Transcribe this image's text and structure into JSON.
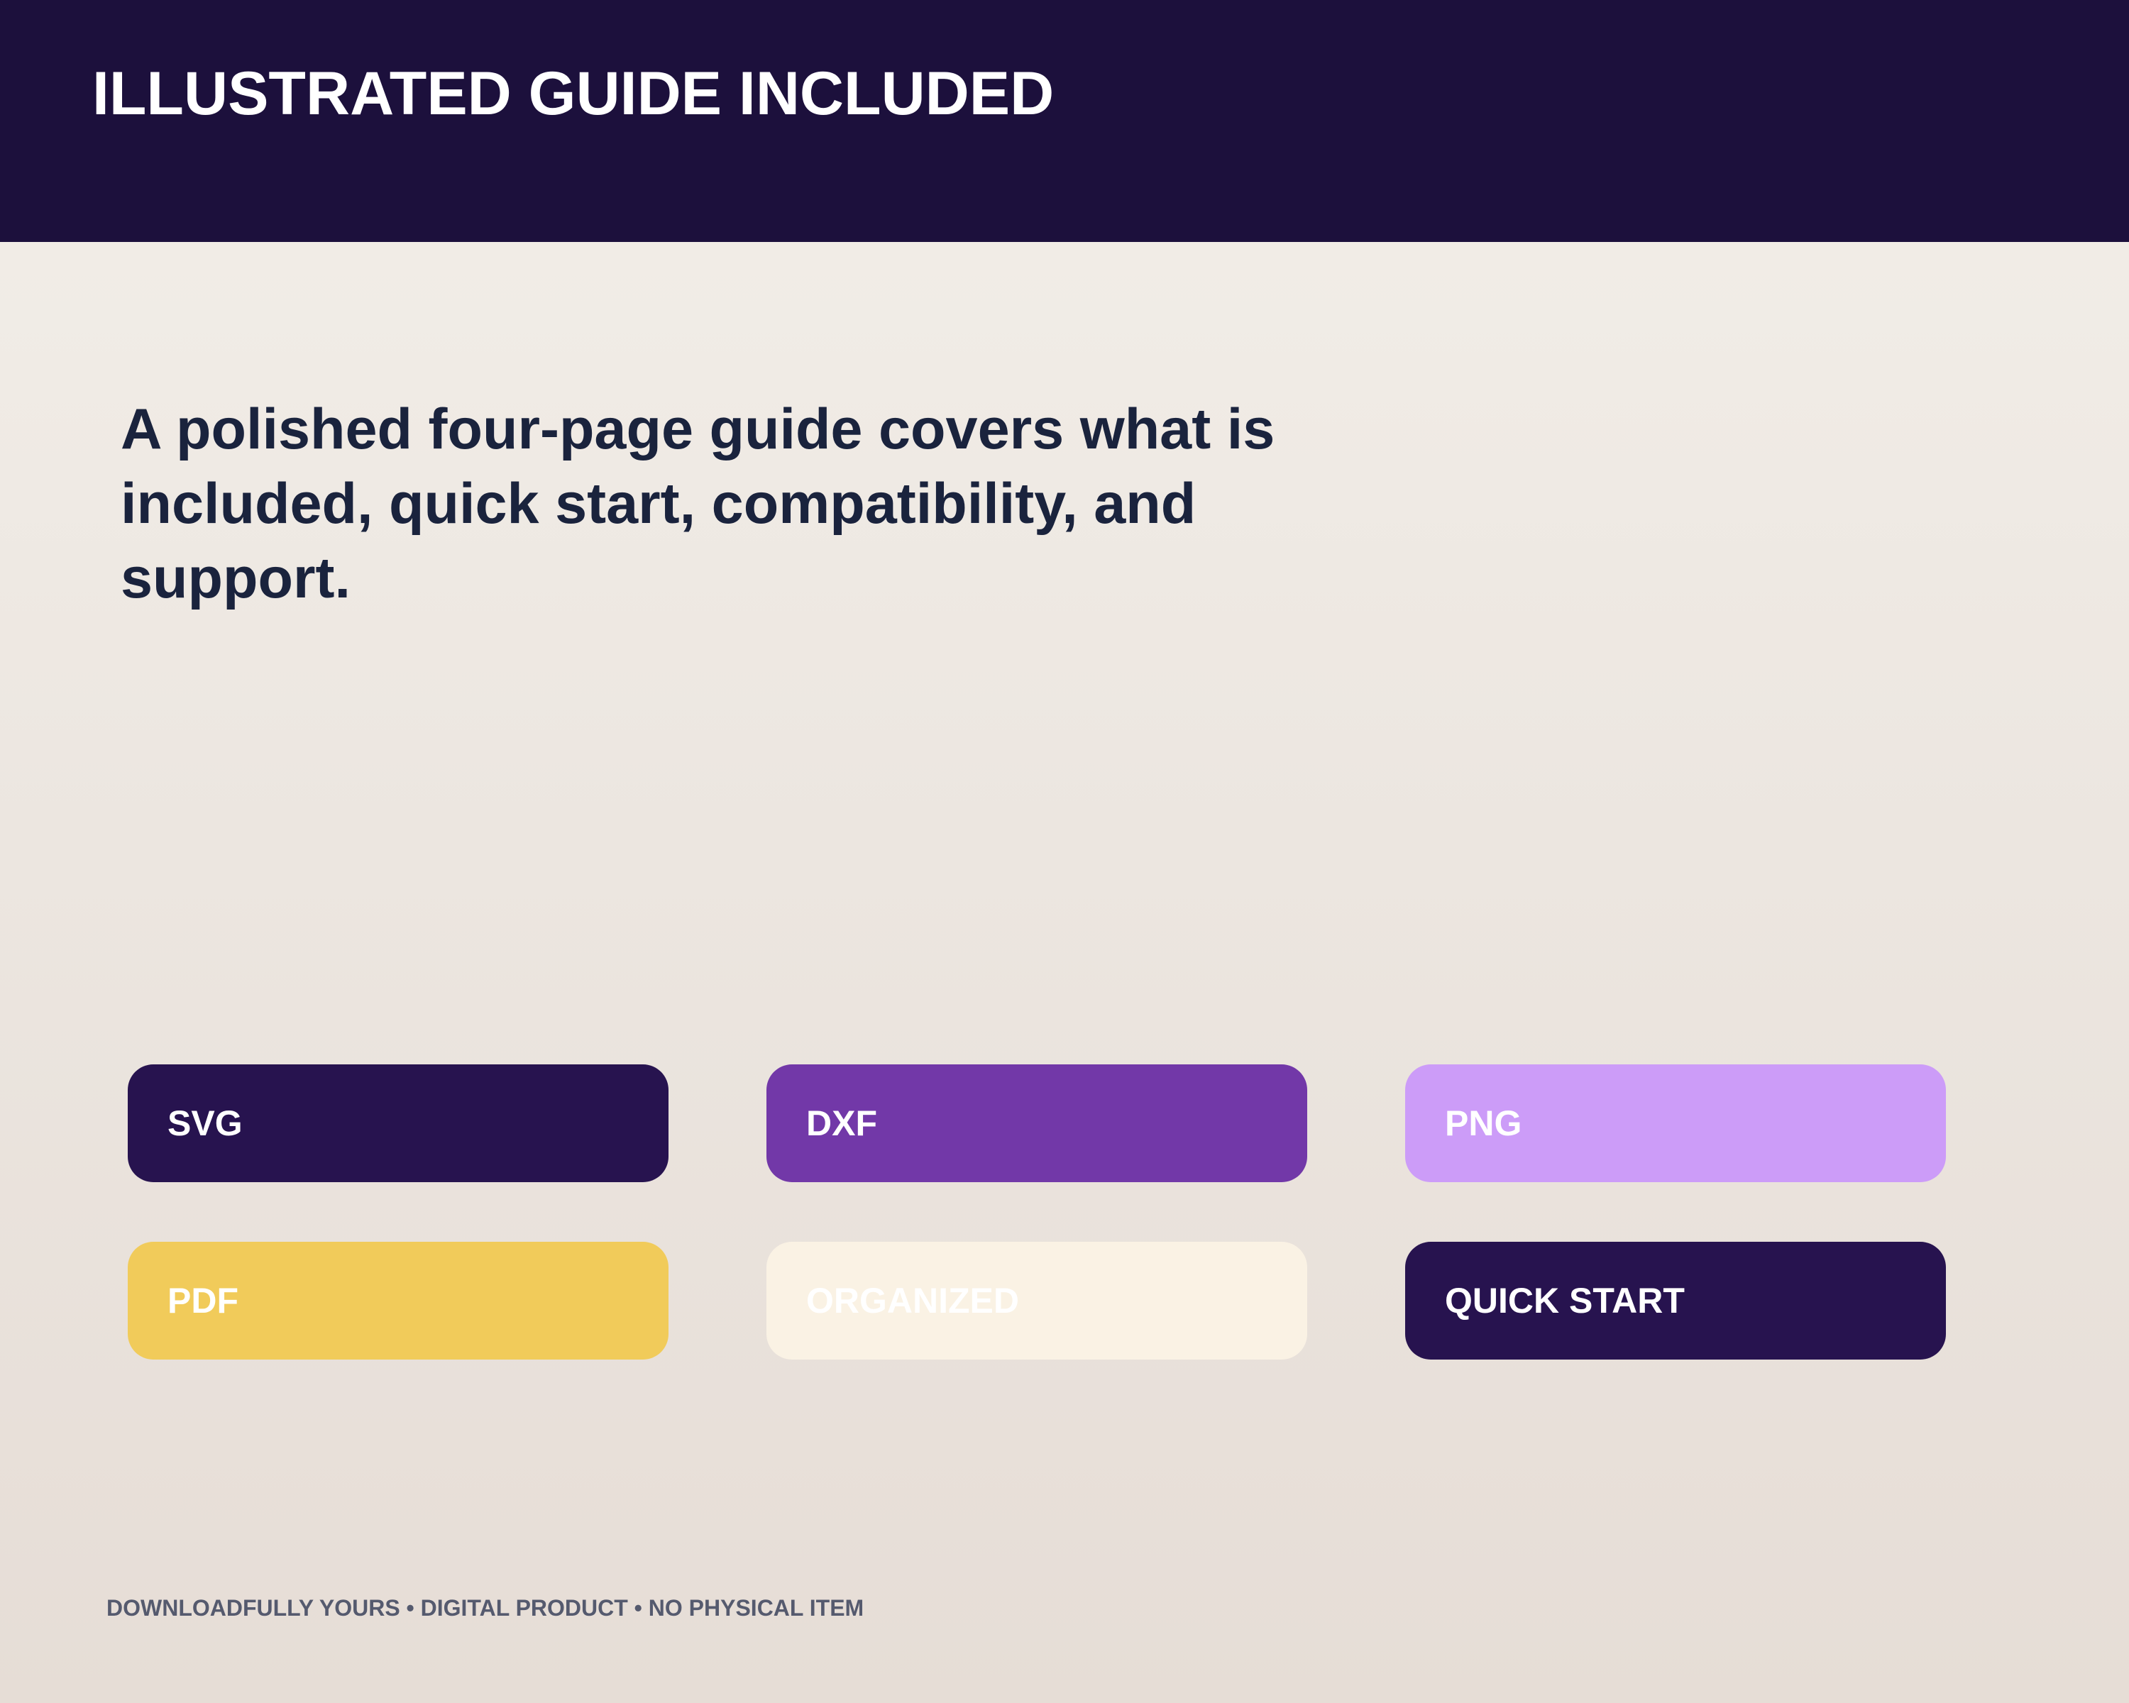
{
  "header": {
    "title": "ILLUSTRATED GUIDE INCLUDED"
  },
  "headline": "A polished four-page guide covers what is included, quick start, compatibility, and support.",
  "chips": [
    {
      "label": "SVG",
      "background": "#27134f",
      "text_color": "#ffffff"
    },
    {
      "label": "DXF",
      "background": "#7238a8",
      "text_color": "#ffffff"
    },
    {
      "label": "PNG",
      "background": "#cc9cf8",
      "text_color": "#ffffff"
    },
    {
      "label": "PDF",
      "background": "#f1cb5a",
      "text_color": "#ffffff"
    },
    {
      "label": "ORGANIZED",
      "background": "#faf2e4",
      "text_color": "#ffffff"
    },
    {
      "label": "QUICK START",
      "background": "#27134f",
      "text_color": "#ffffff"
    }
  ],
  "footer": "DOWNLOADFULLY YOURS • DIGITAL PRODUCT • NO PHYSICAL ITEM",
  "colors": {
    "header_background": "#1c103c",
    "headline_text": "#1a233d",
    "footer_text": "#555a6e"
  }
}
